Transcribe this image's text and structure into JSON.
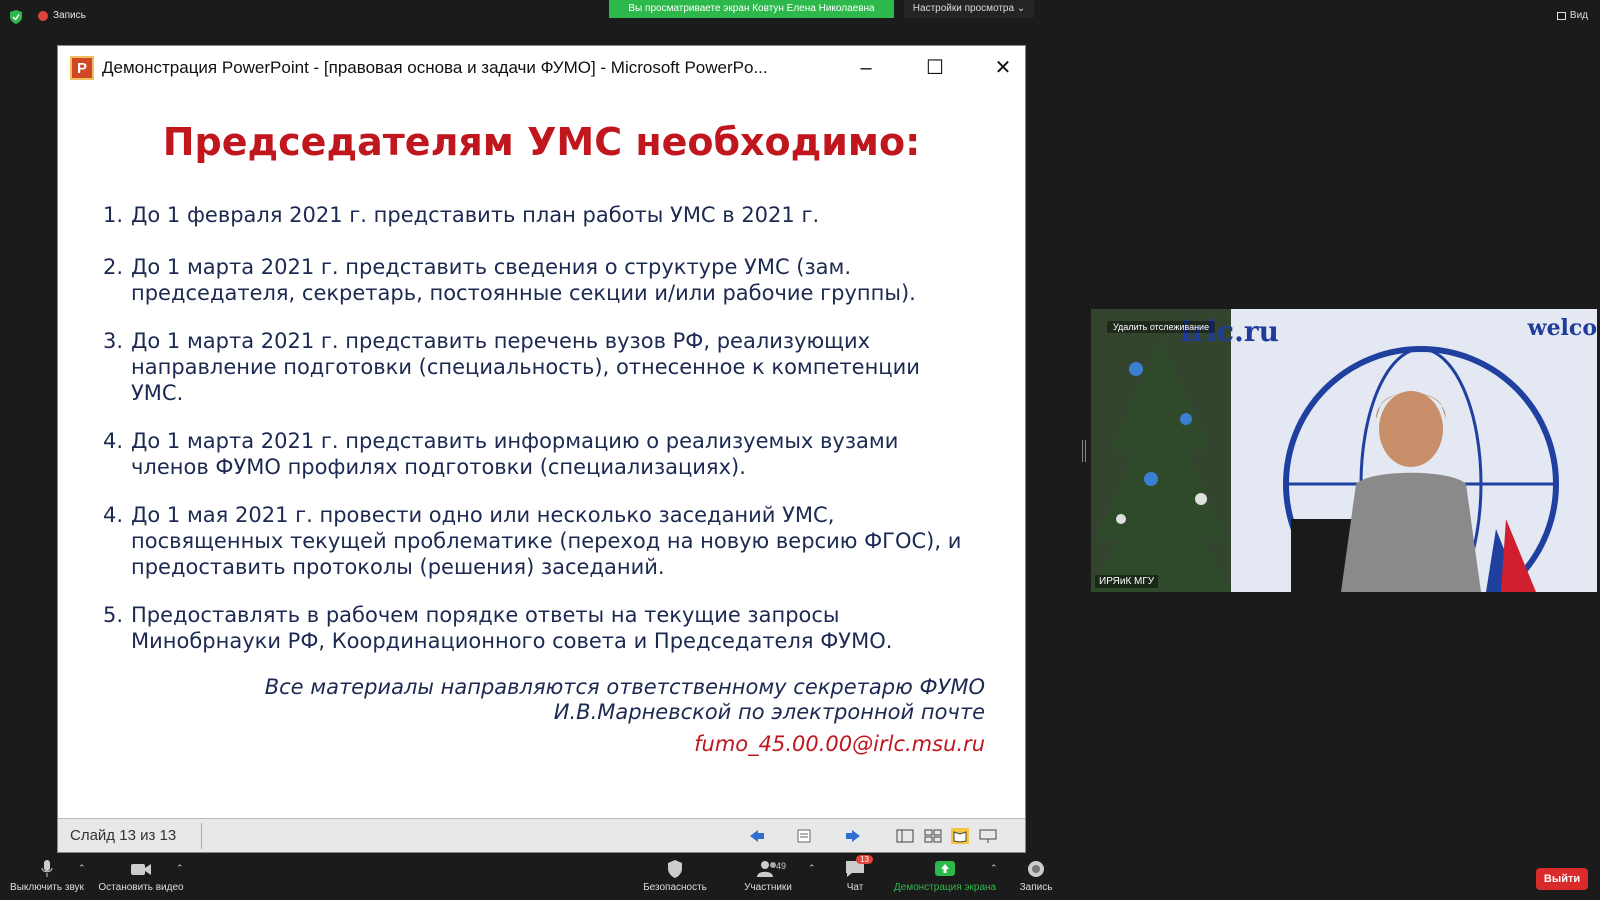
{
  "topbar": {
    "record_label": "Запись",
    "share_banner": "Вы просматриваете экран Ковтун Елена Николаевна",
    "view_settings": "Настройки просмотра ⌄",
    "view_label": "Вид"
  },
  "ppt": {
    "window_title": "Демонстрация PowerPoint - [правовая основа и задачи ФУМО] - Microsoft PowerPo...",
    "logo_letter": "P",
    "slide_title": "Председателям УМС необходимо:",
    "items": [
      {
        "num": "1.",
        "text": "До 1 февраля 2021 г. представить план работы УМС в 2021 г."
      },
      {
        "num": "2.",
        "text": "До 1 марта 2021 г. представить сведения о структуре УМС (зам. председателя, секретарь, постоянные секции и/или рабочие группы)."
      },
      {
        "num": "3.",
        "text": "До 1 марта 2021 г. представить перечень вузов РФ, реализующих направление подготовки (специальность), отнесенное к компетенции УМС."
      },
      {
        "num": "4.",
        "text": "До 1 марта 2021 г. представить информацию о реализуемых вузами членов ФУМО профилях подготовки (специализациях)."
      },
      {
        "num": "4.",
        "text": "До 1 мая 2021 г. провести одно или несколько заседаний УМС, посвященных текущей проблематике (переход на новую версию ФГОС), и предоставить протоколы (решения) заседаний."
      },
      {
        "num": "5.",
        "text": "Предоставлять в рабочем порядке ответы на текущие запросы Минобрнауки РФ, Координационного совета и Председателя ФУМО."
      }
    ],
    "note_line1": "Все материалы направляются ответственному секретарю ФУМО",
    "note_line2": "И.В.Марневской по электронной почте",
    "email": "fumo_45.00.00@irlc.msu.ru",
    "slide_counter": "Слайд 13 из 13"
  },
  "camera": {
    "remove_tracking": "Удалить отслеживание",
    "url_text": "irlc.ru",
    "welcome_text": "welco",
    "participant_name": "ИРЯиК МГУ"
  },
  "toolbar": {
    "mute": "Выключить звук",
    "video": "Остановить видео",
    "security": "Безопасность",
    "participants": "Участники",
    "participants_count": "49",
    "chat": "Чат",
    "chat_badge": "13",
    "share": "Демонстрация экрана",
    "record": "Запись",
    "exit": "Выйти"
  },
  "colors": {
    "share_green": "#2db84b",
    "slide_title_red": "#c0161e",
    "slide_text_navy": "#1c2a52",
    "exit_red": "#d92b2b"
  }
}
